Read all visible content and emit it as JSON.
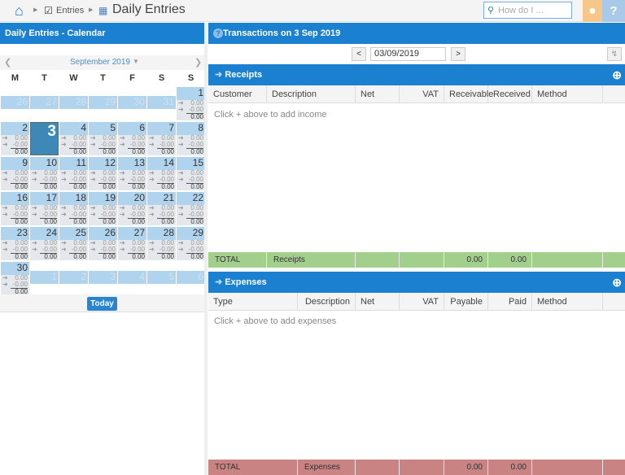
{
  "topbar": {
    "breadcrumb_parent": "Entries",
    "title": "Daily Entries",
    "search_placeholder": "How do I ..."
  },
  "calendar": {
    "header": "Daily Entries - Calendar",
    "month": "September 2019",
    "weekdays": [
      "M",
      "T",
      "W",
      "T",
      "F",
      "S",
      "S"
    ],
    "today_label": "Today",
    "selected_day": "3",
    "prev_days": [
      "26",
      "27",
      "28",
      "29",
      "30",
      "31"
    ],
    "next_days": [
      "1",
      "2",
      "3",
      "4",
      "5",
      "6"
    ],
    "income": "0.00",
    "expense": "-0.00",
    "total": "0.00"
  },
  "transactions": {
    "header": "Transactions on 3 Sep 2019",
    "date": "03/09/2019",
    "prev": "<",
    "next": ">"
  },
  "receipts": {
    "title": "Receipts",
    "columns": [
      "Customer",
      "Description",
      "Net",
      "VAT",
      "Receivable",
      "Received",
      "Method"
    ],
    "empty": "Click + above to add income",
    "total": {
      "label": "TOTAL",
      "name": "Receipts",
      "receivable": "0.00",
      "received": "0.00"
    },
    "total_color": "#a3cf8c"
  },
  "expenses": {
    "title": "Expenses",
    "columns": [
      "Type",
      "Description",
      "Net",
      "VAT",
      "Payable",
      "Paid",
      "Method"
    ],
    "empty": "Click + above to add expenses",
    "total": {
      "label": "TOTAL",
      "name": "Expenses",
      "payable": "0.00",
      "paid": "0.00"
    },
    "total_color": "#c98383"
  },
  "colors": {
    "accent": "#1a80cf"
  }
}
